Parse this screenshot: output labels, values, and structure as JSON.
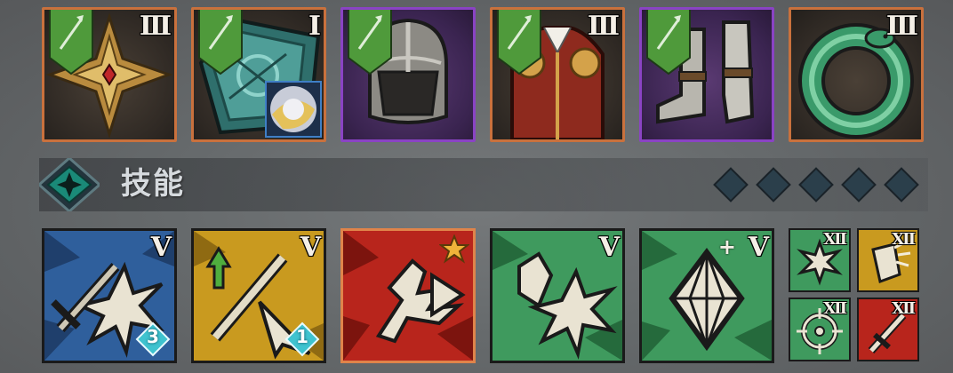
{
  "equipment": [
    {
      "name": "weapon",
      "rarity": "legendary",
      "tier": "III",
      "equipped_badge": true
    },
    {
      "name": "shield",
      "rarity": "legendary",
      "tier": "I",
      "equipped_badge": true,
      "has_inset": true
    },
    {
      "name": "helmet",
      "rarity": "epic",
      "tier": "",
      "equipped_badge": true
    },
    {
      "name": "armor",
      "rarity": "legendary",
      "tier": "III",
      "equipped_badge": true
    },
    {
      "name": "boots",
      "rarity": "epic",
      "tier": "",
      "equipped_badge": true
    },
    {
      "name": "ring",
      "rarity": "legendary",
      "tier": "III",
      "equipped_badge": false
    }
  ],
  "colors": {
    "legendary_border": "#c9713d",
    "epic_border": "#8a43c4",
    "badge_green": "#4f9a3b",
    "skill_blue": "#2f5f9c",
    "skill_yellow": "#c99a1f",
    "skill_red": "#b8251c",
    "skill_green": "#3f9a5e"
  },
  "skills_section": {
    "title": "技能",
    "point_slots": 5
  },
  "skills": [
    {
      "name": "sword-burst",
      "color": "blue",
      "tier": "V",
      "gem_count": "3"
    },
    {
      "name": "sword-arrow",
      "color": "yellow",
      "tier": "V",
      "gem_count": "1"
    },
    {
      "name": "dash-strike",
      "color": "red",
      "starred": true
    },
    {
      "name": "crystal-burst",
      "color": "green",
      "tier": "V"
    },
    {
      "name": "crystal",
      "color": "green",
      "tier": "V",
      "plus": "+"
    }
  ],
  "mini_skills": [
    {
      "name": "impact",
      "color": "green",
      "tier": "XII"
    },
    {
      "name": "shield-break",
      "color": "yellow",
      "tier": "XII"
    },
    {
      "name": "target",
      "color": "green",
      "tier": "XII"
    },
    {
      "name": "dagger",
      "color": "red",
      "tier": "XII"
    }
  ]
}
